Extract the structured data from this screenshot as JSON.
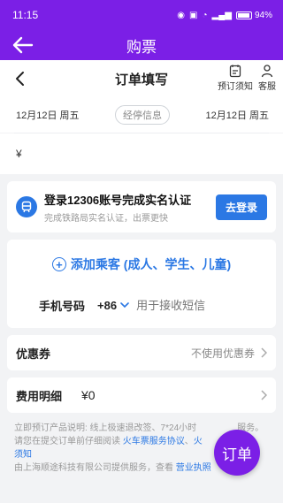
{
  "status_bar": {
    "time": "11:15",
    "battery": "94%"
  },
  "app_bar": {
    "title": "购票"
  },
  "order": {
    "title": "订单填写",
    "notice_label": "预订须知",
    "service_label": "客服"
  },
  "trip": {
    "depart_date": "12月12日 周五",
    "stop_info": "经停信息",
    "arrive_date": "12月12日 周五",
    "price": "¥"
  },
  "login": {
    "title": "登录12306账号完成实名认证",
    "subtitle": "完成铁路局实名认证，出票更快",
    "button": "去登录"
  },
  "passenger": {
    "add_label": "添加乘客 (成人、学生、儿童)",
    "phone_label": "手机号码",
    "phone_code": "+86",
    "phone_placeholder": "用于接收短信"
  },
  "coupon": {
    "label": "优惠券",
    "value": "不使用优惠券"
  },
  "fee": {
    "label": "费用明细",
    "value": "¥0"
  },
  "notice": {
    "line1": "立即预订产品说明: 线上极速退改签、7*24小时",
    "line1_tail": "服务。",
    "line2": "请您在提交订单前仔细阅读",
    "link1": "火车票服务协议",
    "line2_sep": "、",
    "link2": "火",
    "link3": "须知",
    "line3": "由上海顺途科技有限公司提供服务，查看",
    "link4": "营业执照"
  },
  "fab": {
    "label": "订单"
  },
  "colors": {
    "brand_purple": "#7b1fe6",
    "accent_blue": "#2b78e4"
  }
}
